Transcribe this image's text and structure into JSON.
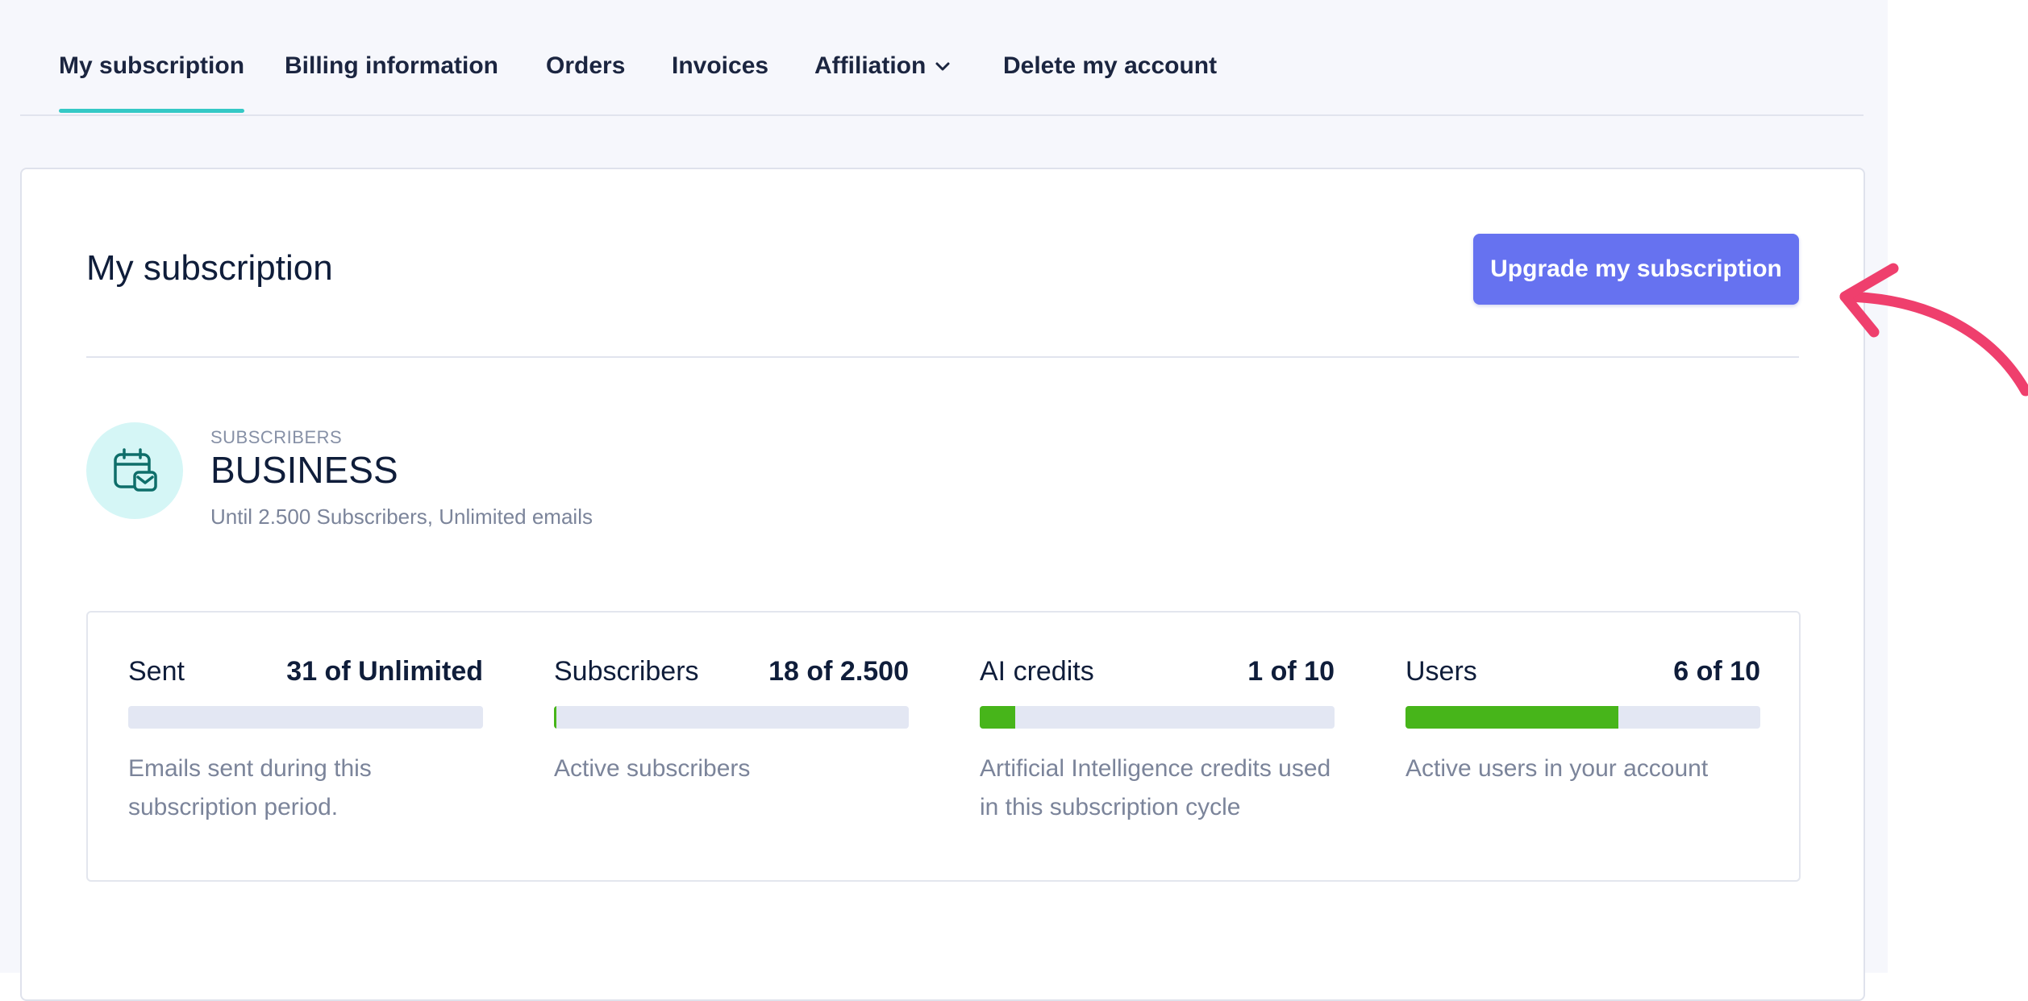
{
  "tabs": [
    {
      "label": "My subscription",
      "active": true
    },
    {
      "label": "Billing information"
    },
    {
      "label": "Orders"
    },
    {
      "label": "Invoices"
    },
    {
      "label": "Affiliation",
      "has_dropdown": true
    },
    {
      "label": "Delete my account"
    }
  ],
  "card": {
    "title": "My subscription",
    "upgrade_label": "Upgrade my subscription"
  },
  "plan": {
    "icon": "calendar-mail-icon",
    "kicker": "SUBSCRIBERS",
    "name": "BUSINESS",
    "description": "Until 2.500 Subscribers, Unlimited emails"
  },
  "stats": [
    {
      "label": "Sent",
      "value": "31 of Unlimited",
      "progress": 0,
      "description": "Emails sent during this subscription period."
    },
    {
      "label": "Subscribers",
      "value": "18 of 2.500",
      "progress": 0.007,
      "description": "Active subscribers"
    },
    {
      "label": "AI credits",
      "value": "1 of 10",
      "progress": 0.1,
      "description": "Artificial Intelligence credits used in this subscription cycle"
    },
    {
      "label": "Users",
      "value": "6 of 10",
      "progress": 0.6,
      "description": "Active users in your account"
    }
  ],
  "colors": {
    "accent": "#6672f0",
    "tab_indicator": "#35c9c6",
    "progress": "#47b51a",
    "annotation_arrow": "#ef3f6d"
  }
}
